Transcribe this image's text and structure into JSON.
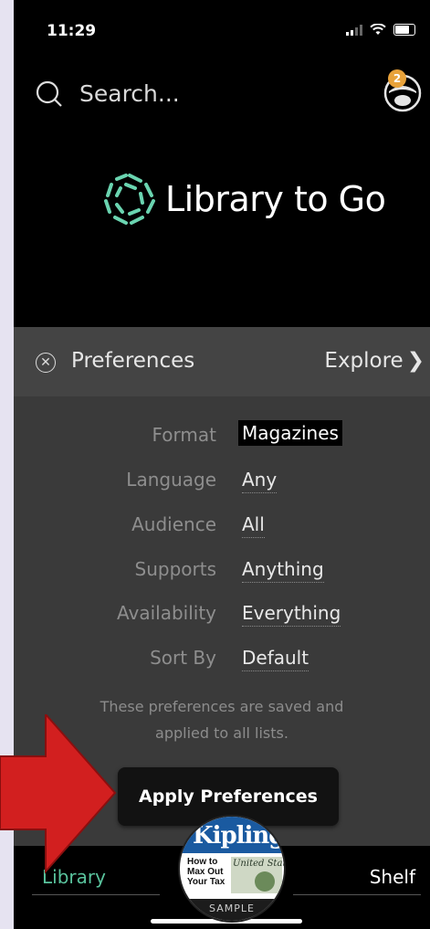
{
  "status_bar": {
    "time": "11:29"
  },
  "header": {
    "search_placeholder": "Search...",
    "notification_count": "2"
  },
  "logo": {
    "text": "Library to Go"
  },
  "preferences": {
    "title": "Preferences",
    "explore_label": "Explore",
    "rows": [
      {
        "label": "Format",
        "value": "Magazines",
        "selected": true
      },
      {
        "label": "Language",
        "value": "Any"
      },
      {
        "label": "Audience",
        "value": "All"
      },
      {
        "label": "Supports",
        "value": "Anything"
      },
      {
        "label": "Availability",
        "value": "Everything"
      },
      {
        "label": "Sort By",
        "value": "Default"
      }
    ],
    "note_line1": "These preferences are saved and",
    "note_line2": "applied to all lists.",
    "apply_label": "Apply Preferences"
  },
  "tabbar": {
    "library_label": "Library",
    "shelf_label": "Shelf"
  },
  "sample_cover": {
    "brand": "Kiplinger",
    "headline": "How to Max Out Your Tax",
    "art_title": "United States",
    "label": "SAMPLE"
  },
  "colors": {
    "accent_green": "#59c39d",
    "badge_orange": "#e8a23a",
    "annotation_red": "#d21f1f"
  }
}
